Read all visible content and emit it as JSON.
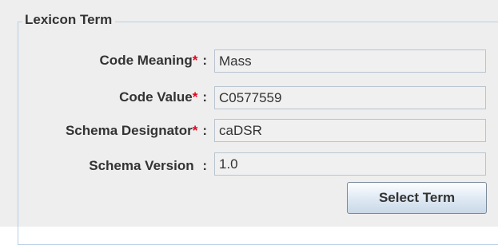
{
  "group": {
    "title": "Lexicon Term"
  },
  "fields": [
    {
      "label": "Code Meaning",
      "required_mark": "*",
      "colon": ":",
      "value": "Mass"
    },
    {
      "label": "Code Value",
      "required_mark": "*",
      "colon": ":",
      "value": "C0577559"
    },
    {
      "label": "Schema Designator",
      "required_mark": "*",
      "colon": ":",
      "value": "caDSR"
    },
    {
      "label": "Schema Version ",
      "required_mark": "",
      "colon": ":",
      "value": "1.0"
    }
  ],
  "actions": {
    "select_term_label": "Select Term"
  },
  "colors": {
    "required_mark": "#e8001c",
    "group_border": "#b8cfe5",
    "panel_background": "#eeeeee"
  }
}
